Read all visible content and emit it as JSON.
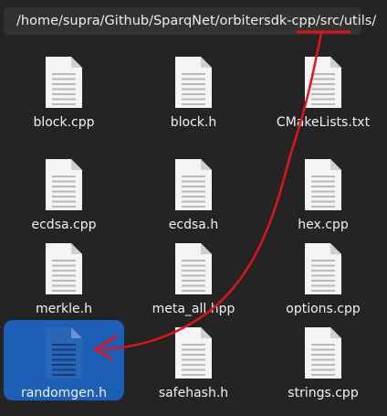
{
  "pathbar": {
    "path": "/home/supra/Github/SparqNet/orbitersdk-cpp/src/utils/",
    "icon": "folder-icon"
  },
  "files": [
    {
      "name": "block.cpp",
      "icon": "text-document-icon",
      "selected": false
    },
    {
      "name": "block.h",
      "icon": "text-document-icon",
      "selected": false
    },
    {
      "name": "CMakeLists.txt",
      "icon": "text-document-icon",
      "selected": false
    },
    {
      "name": "ecdsa.cpp",
      "icon": "text-document-icon",
      "selected": false
    },
    {
      "name": "ecdsa.h",
      "icon": "text-document-icon",
      "selected": false
    },
    {
      "name": "hex.cpp",
      "icon": "text-document-icon",
      "selected": false
    },
    {
      "name": "merkle.h",
      "icon": "text-document-icon",
      "selected": false
    },
    {
      "name": "meta_all.hpp",
      "icon": "text-document-icon",
      "selected": false
    },
    {
      "name": "options.cpp",
      "icon": "text-document-icon",
      "selected": false
    },
    {
      "name": "randomgen.h",
      "icon": "text-document-icon",
      "selected": true
    },
    {
      "name": "safehash.h",
      "icon": "text-document-icon",
      "selected": false
    },
    {
      "name": "strings.cpp",
      "icon": "text-document-icon",
      "selected": false
    }
  ],
  "colors": {
    "background": "#242424",
    "selection": "#1c5fb6",
    "annotation": "#e0141e"
  }
}
